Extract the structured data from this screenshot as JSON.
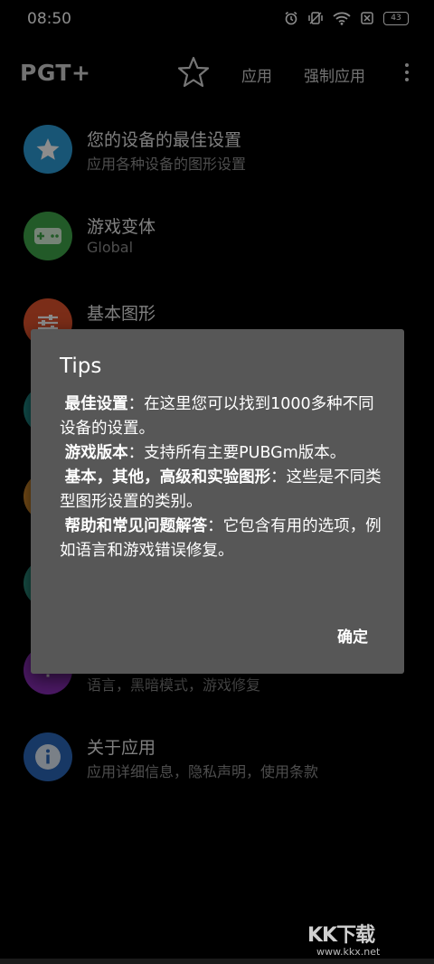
{
  "status_bar": {
    "time": "08:50",
    "battery": "43",
    "icons": [
      "alarm-icon",
      "vibrate-icon",
      "wifi-icon",
      "sim-off-icon",
      "battery-icon"
    ]
  },
  "app_bar": {
    "title": "PGT+",
    "actions": {
      "apply": "应用",
      "force_apply": "强制应用"
    },
    "icons": [
      "star-outline-icon",
      "more-vert-icon"
    ]
  },
  "list": [
    {
      "title": "您的设备的最佳设置",
      "subtitle": "应用各种设备的图形设置",
      "icon": "star-icon",
      "color": "#2d9bd6"
    },
    {
      "title": "游戏变体",
      "subtitle": "Global",
      "icon": "gamepad-icon",
      "color": "#3fa44a"
    },
    {
      "title": "基本图形",
      "subtitle": "",
      "icon": "sliders-icon",
      "color": "#e0522c"
    },
    {
      "title": "",
      "subtitle": "",
      "icon": "",
      "color": "#1f8f8a"
    },
    {
      "title": "",
      "subtitle": "",
      "icon": "",
      "color": "#d58a2b"
    },
    {
      "title": "",
      "subtitle": "",
      "icon": "",
      "color": "#2a8f7f"
    },
    {
      "title": "",
      "subtitle": "语言，黑暗模式，游戏修复",
      "icon": "help-icon",
      "color": "#8a2fb8"
    },
    {
      "title": "关于应用",
      "subtitle": "应用详细信息，隐私声明，使用条款",
      "icon": "info-icon",
      "color": "#2b67b8"
    }
  ],
  "dialog": {
    "title": "Tips",
    "paragraphs": [
      {
        "label": "最佳设置",
        "text": "：在这里您可以找到1000多种不同设备的设置。"
      },
      {
        "label": "游戏版本",
        "text": "：支持所有主要PUBGm版本。"
      },
      {
        "label": "基本，其他，高级和实验图形",
        "text": "：这些是不同类型图形设置的类别。"
      },
      {
        "label": "帮助和常见问题解答",
        "text": "：它包含有用的选项，例如语言和游戏错误修复。"
      }
    ],
    "ok_label": "确定"
  },
  "watermark": {
    "logo": "KK下载",
    "url": "www.kkx.net"
  }
}
